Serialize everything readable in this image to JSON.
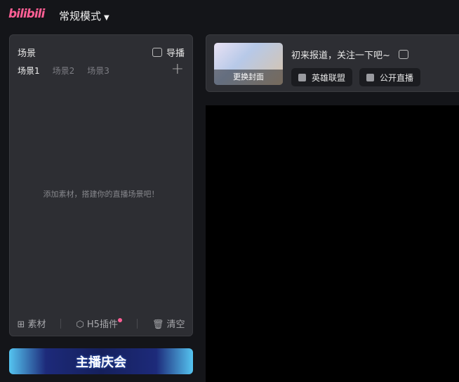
{
  "logo": "bilibili",
  "mode": "常规模式",
  "scene": {
    "title": "场景",
    "director": "导播",
    "tabs": [
      "场景1",
      "场景2",
      "场景3"
    ],
    "empty_hint": "添加素材，搭建你的直播场景吧！",
    "footer": {
      "material": "素材",
      "h5": "H5插件",
      "clear": "清空"
    }
  },
  "banner": "主播庆会",
  "live": {
    "cover_label": "更换封面",
    "title": "初来报道，关注一下吧~",
    "category": "英雄联盟",
    "visibility": "公开直播"
  }
}
